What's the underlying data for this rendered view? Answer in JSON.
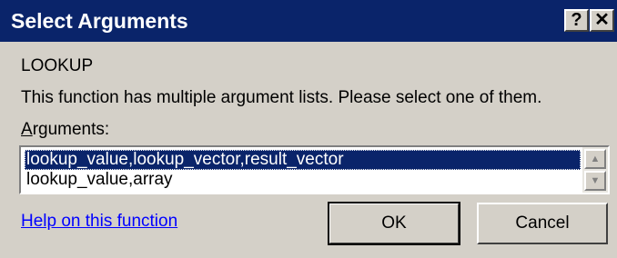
{
  "dialog": {
    "title": "Select Arguments",
    "help_button": "?",
    "close_button": "✕",
    "function_name": "LOOKUP",
    "description": "This function has multiple argument lists.  Please select one of them.",
    "arguments_label_accel": "A",
    "arguments_label_rest": "rguments:",
    "argument_lists": [
      "lookup_value,lookup_vector,result_vector",
      "lookup_value,array"
    ],
    "selected_index": 0,
    "help_link": "Help on this function",
    "ok_label": "OK",
    "cancel_label": "Cancel"
  },
  "colors": {
    "titlebar": "#0a246a",
    "face": "#d4d0c8",
    "selection": "#0a246a",
    "link": "#0000ff"
  },
  "icons": {
    "scroll_up": "scroll-up-arrow-icon",
    "scroll_down": "scroll-down-arrow-icon"
  }
}
